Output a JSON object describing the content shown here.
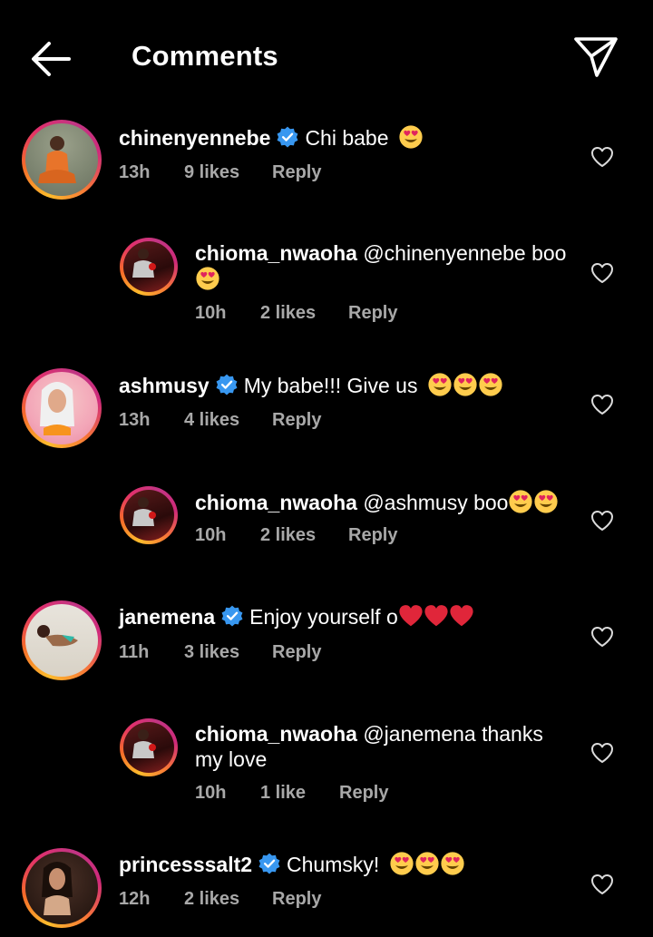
{
  "header": {
    "title": "Comments",
    "back_icon": "arrow-left-icon",
    "send_icon": "paper-plane-icon"
  },
  "colors": {
    "background": "#000000",
    "meta_text": "#a8a8a8",
    "verified_blue": "#3897f0",
    "heart_red": "#e0263a"
  },
  "comments": [
    {
      "username": "chinenyennebe",
      "verified": true,
      "text": "Chi babe",
      "emojis": [
        "smiling-face-with-heart-eyes"
      ],
      "time": "13h",
      "likes": "9 likes",
      "reply": "Reply"
    },
    {
      "username": "chioma_nwaoha",
      "verified": false,
      "text": "@chinenyennebe boo",
      "emojis": [
        "smiling-face-with-heart-eyes"
      ],
      "time": "10h",
      "likes": "2 likes",
      "reply": "Reply"
    },
    {
      "username": "ashmusy",
      "verified": true,
      "text": "My babe!!! Give us",
      "emojis": [
        "smiling-face-with-heart-eyes",
        "smiling-face-with-heart-eyes",
        "smiling-face-with-heart-eyes"
      ],
      "time": "13h",
      "likes": "4 likes",
      "reply": "Reply"
    },
    {
      "username": "chioma_nwaoha",
      "verified": false,
      "text": "@ashmusy boo",
      "emojis": [
        "smiling-face-with-heart-eyes",
        "smiling-face-with-heart-eyes"
      ],
      "time": "10h",
      "likes": "2 likes",
      "reply": "Reply"
    },
    {
      "username": "janemena",
      "verified": true,
      "text": "Enjoy yourself o",
      "emojis": [
        "red-heart",
        "red-heart",
        "red-heart"
      ],
      "time": "11h",
      "likes": "3 likes",
      "reply": "Reply"
    },
    {
      "username": "chioma_nwaoha",
      "verified": false,
      "text": "@janemena thanks my love",
      "emojis": [],
      "time": "10h",
      "likes": "1 like",
      "reply": "Reply"
    },
    {
      "username": "princesssalt2",
      "verified": true,
      "text": "Chumsky!",
      "emojis": [
        "smiling-face-with-heart-eyes",
        "smiling-face-with-heart-eyes",
        "smiling-face-with-heart-eyes"
      ],
      "time": "12h",
      "likes": "2 likes",
      "reply": "Reply"
    }
  ]
}
